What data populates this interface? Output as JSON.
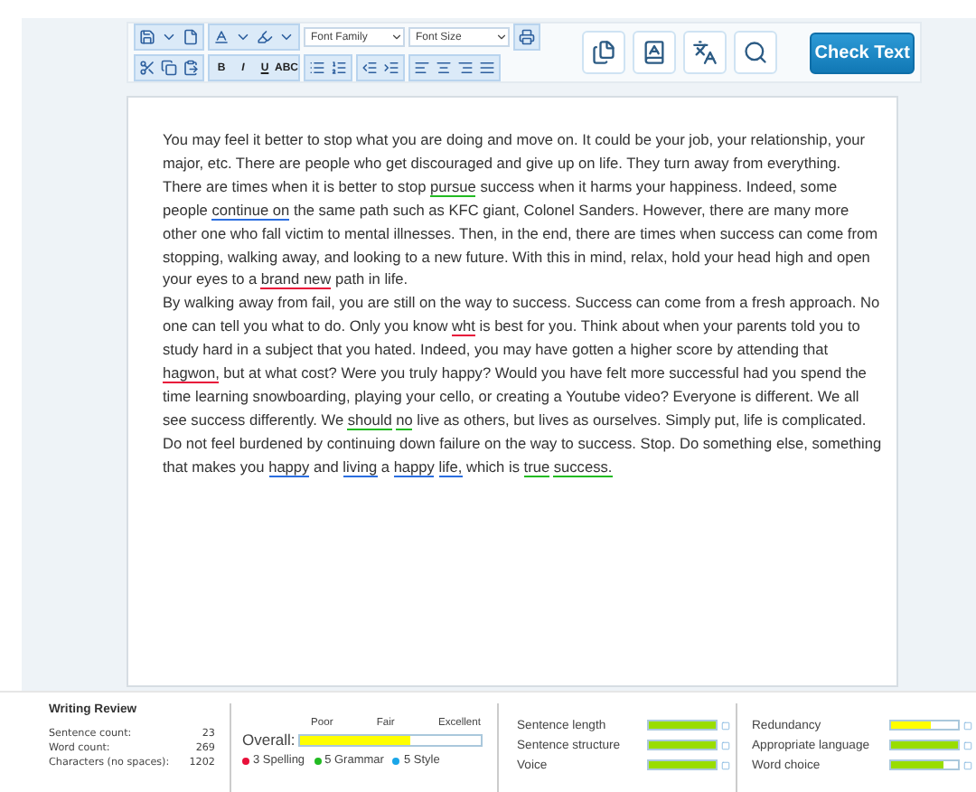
{
  "toolbar": {
    "font_family": "Font Family",
    "font_size": "Font Size",
    "format_buttons": [
      "B",
      "I",
      "U",
      "ABC"
    ],
    "check_button": "Check Text"
  },
  "editor": {
    "paragraphs": [
      [
        {
          "text": "You may feel it better to stop what you are doing and move on. It could be your job, your relationship, your major, etc. There are people who get discouraged and give up on life. They turn away from everything. There are times when it is better to stop "
        },
        {
          "text": "pursue",
          "color": "#22bb22"
        },
        {
          "text": " success when it harms your happiness. Indeed, some people "
        },
        {
          "text": "continue on",
          "color": "#2a6ee0"
        },
        {
          "text": " the same path such as KFC giant, Colonel Sanders. However, there are many more other one who fall victim to mental illnesses. Then, in the end, there are times when success can come from stopping, walking away, and looking to a new future. With this in mind, relax, hold your head high and open your eyes to a "
        },
        {
          "text": "brand new",
          "color": "#e8113a"
        },
        {
          "text": " path in life."
        }
      ],
      [
        {
          "text": "By walking away from fail, you are still on the way to success. Success can come from a fresh approach. No one can tell you what to do. Only you know "
        },
        {
          "text": "wht",
          "color": "#e8113a"
        },
        {
          "text": " is best for you. Think about when your parents told you to study hard in a subject that you hated. Indeed, you may have gotten a higher score by attending that "
        },
        {
          "text": "hagwon,",
          "color": "#e8113a"
        },
        {
          "text": " but at what cost? Were you truly happy? Would you have felt more successful had you spend the time learning snowboarding, playing your cello, or creating a Youtube video? Everyone is different. We all see success differently. We "
        },
        {
          "text": "should",
          "color": "#22bb22"
        },
        {
          "text": "no",
          "color": "#22bb22"
        },
        {
          "text": " live as others, but lives as ourselves. Simply put, life is complicated. Do not feel burdened by continuing down failure on the way to success. Stop. Do something else, something that makes you "
        },
        {
          "text": "happy",
          "color": "#2a6ee0"
        },
        {
          "text": " and "
        },
        {
          "text": "living",
          "color": "#2a6ee0"
        },
        {
          "text": " a "
        },
        {
          "text": "happy",
          "color": "#2a6ee0"
        },
        {
          "text": "life,",
          "color": "#2a6ee0"
        },
        {
          "text": " which is "
        },
        {
          "text": "true",
          "color": "#22bb22"
        },
        {
          "text": "success.",
          "color": "#22bb22"
        }
      ]
    ]
  },
  "review": {
    "title": "Writing Review",
    "stats": [
      {
        "label": "Sentence count:",
        "value": "23"
      },
      {
        "label": "Word count:",
        "value": "269"
      },
      {
        "label": "Characters (no spaces):",
        "value": "1202"
      }
    ],
    "overall": {
      "label": "Overall:",
      "scale": [
        "Poor",
        "Fair",
        "Excellent"
      ],
      "level": 0.61,
      "color": "#ffff00"
    },
    "counts": [
      {
        "text": "3 Spelling",
        "color": "#e8113a"
      },
      {
        "text": "5 Grammar",
        "color": "#22bb22"
      },
      {
        "text": "5 Style",
        "color": "#1aa6e8"
      }
    ],
    "metrics": [
      [
        {
          "label": "Sentence length",
          "level": 1,
          "color": "#99dd00"
        },
        {
          "label": "Sentence structure",
          "level": 1,
          "color": "#99dd00"
        },
        {
          "label": "Voice",
          "level": 1,
          "color": "#99dd00"
        }
      ],
      [
        {
          "label": "Redundancy",
          "level": 0.6,
          "color": "#ffff00"
        },
        {
          "label": "Appropriate language",
          "level": 1,
          "color": "#99dd00"
        },
        {
          "label": "Word choice",
          "level": 0.78,
          "color": "#99dd00"
        }
      ]
    ]
  }
}
